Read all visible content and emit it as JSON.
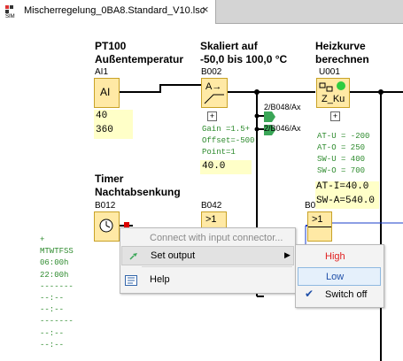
{
  "tab": {
    "title": "Mischerregelung_0BA8.Standard_V10.lsc",
    "close": "×",
    "icon": "sim-program-icon"
  },
  "blocks": {
    "ai1": {
      "title1": "PT100",
      "title2": "Außentemperatur",
      "id": "AI1",
      "symbol": "AI",
      "values": [
        "40",
        "360"
      ]
    },
    "b002": {
      "title1": "Skaliert auf",
      "title2": "-50,0 bis 100,0 °C",
      "id": "B002",
      "symbol": "A→",
      "params": [
        "Gain =1.5+",
        "Offset=-500",
        "Point=1"
      ],
      "value": "40.0"
    },
    "u001": {
      "title1": "Heizkurve",
      "title2": "berechnen",
      "id": "U001",
      "symbol": "Z_Ku",
      "params": [
        "AT-U = -200",
        "AT-O = 250",
        "SW-U = 400",
        "SW-O = 700"
      ],
      "values": [
        "AT-I=40.0",
        "SW-A=540.0"
      ]
    },
    "b012": {
      "title1": "Timer",
      "title2": "Nachtabsenkung",
      "id": "B012",
      "params": [
        "+",
        "MTWTFSS",
        "06:00h",
        "22:00h",
        "-------",
        "--:--",
        "--:--",
        "-------",
        "--:--",
        "--:--"
      ]
    },
    "b042": {
      "id": "B042",
      "symbol": ">1"
    },
    "b_right": {
      "id": "B0",
      "symbol": ">1"
    }
  },
  "connectors": [
    "2/B048/Ax",
    "2/B046/Ax"
  ],
  "context_menu": {
    "items": [
      {
        "label": "Connect with input connector...",
        "disabled": true
      },
      {
        "label": "Set output",
        "has_submenu": true
      },
      {
        "label": "Help"
      }
    ]
  },
  "submenu": {
    "items": [
      {
        "label": "High",
        "color": "#e02020"
      },
      {
        "label": "Low",
        "color": "#1f4fa8"
      },
      {
        "label": "Switch off",
        "checked": true
      }
    ]
  },
  "colors": {
    "line": "#000000",
    "blue_line": "#1a3cc8",
    "block_fill": "#ffe9a5",
    "value_bg": "#ffffc8",
    "param_green": "#2e8b2e"
  }
}
